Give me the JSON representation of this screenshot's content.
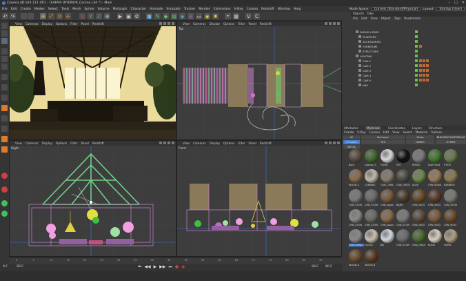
{
  "window": {
    "title": "Cinema 4D S24.111 (RC) - [SAFARI INTERIOR_Corona.c4d *] - Main",
    "controls": [
      "–",
      "□",
      "✕"
    ]
  },
  "menu": [
    "File",
    "Edit",
    "Create",
    "Modes",
    "Select",
    "Tools",
    "Mesh",
    "Spline",
    "Volume",
    "MoGraph",
    "Character",
    "Animate",
    "Simulate",
    "Tracker",
    "Render",
    "Extensions",
    "V-Ray",
    "Corona",
    "Redshift",
    "Window",
    "Help"
  ],
  "menu_right": {
    "node_label": "Node Space:",
    "node_value": "Current (Standard/Physical)",
    "layout_label": "Layout:",
    "layout_value": "Startup (User)"
  },
  "viewport_menu": [
    "View",
    "Cameras",
    "Display",
    "Options",
    "Filter",
    "Panel",
    "Redshift"
  ],
  "viewports": [
    {
      "label": ""
    },
    {
      "label": "Top"
    },
    {
      "label": "Right"
    },
    {
      "label": "Front"
    }
  ],
  "objects_panel": {
    "tabs": [
      "Objects",
      "Take"
    ],
    "menu": [
      "File",
      "Edit",
      "View",
      "Object",
      "Tags",
      "Bookmarks"
    ],
    "items": [
      "SAFARI LODGE",
      "PLANTERS",
      "ACCESSORIES",
      "FURNITURE",
      "STRUCTURE",
      "LIGHTING",
      "CAM 1",
      "CAM 2",
      "CAM 3",
      "CAM 4",
      "CAM 5",
      "NAV"
    ]
  },
  "materials_panel": {
    "tabs": [
      "Attributes",
      "Materials",
      "Coordinates",
      "Layers",
      "Structure"
    ],
    "menu": [
      "Create",
      "V-Ray",
      "Corona",
      "Edit",
      "View",
      "Select",
      "Material",
      "Texture"
    ],
    "cats_row1": [
      "All",
      "No Layer",
      "Glass",
      "BUILDING MATERIALS"
    ],
    "cats_row2": [
      "ORGANIC",
      "TEX",
      "FABRIC",
      "OTHER"
    ],
    "cats_row3": [
      "METAL"
    ],
    "materials": [
      "Bark",
      "Leaves_G",
      "HORN",
      "EYE",
      "RHINO",
      "Leaf Front",
      "STEM",
      "WOOD C",
      "CERAMIC",
      "CRN_CERA",
      "CRN_GROU",
      "ALOE",
      "CRN_BOWL",
      "BAMBOO",
      "CRN_STON",
      "CRN_STON",
      "CRN_wood",
      "BARK",
      "CRN_WOO",
      "CRN_WOO",
      "CRN_STON",
      "CRN_STON",
      "CRN_STON",
      "CRN_wood",
      "CRN_STON",
      "CRN_WOO",
      "CRN_WOO",
      "CRN_WOO",
      "CRN_CONC",
      "FLOOR",
      "BG",
      "CRN_STON",
      "CRN_GRAS",
      "BONE",
      "HORN",
      "WOOD A",
      "WOOD B"
    ]
  },
  "timeline": {
    "start": "0 F",
    "end": "90 F",
    "ticks": [
      "0",
      "5",
      "10",
      "15",
      "20",
      "25",
      "30",
      "35",
      "40",
      "45",
      "50",
      "55",
      "60",
      "65",
      "70",
      "75",
      "80",
      "85",
      "90"
    ],
    "right_start": "90 F",
    "right_end": "90 F"
  },
  "colors": {
    "accent": "#e07a2b",
    "structure_green": "#6fd08a",
    "select_blue": "#3a7bd5"
  }
}
